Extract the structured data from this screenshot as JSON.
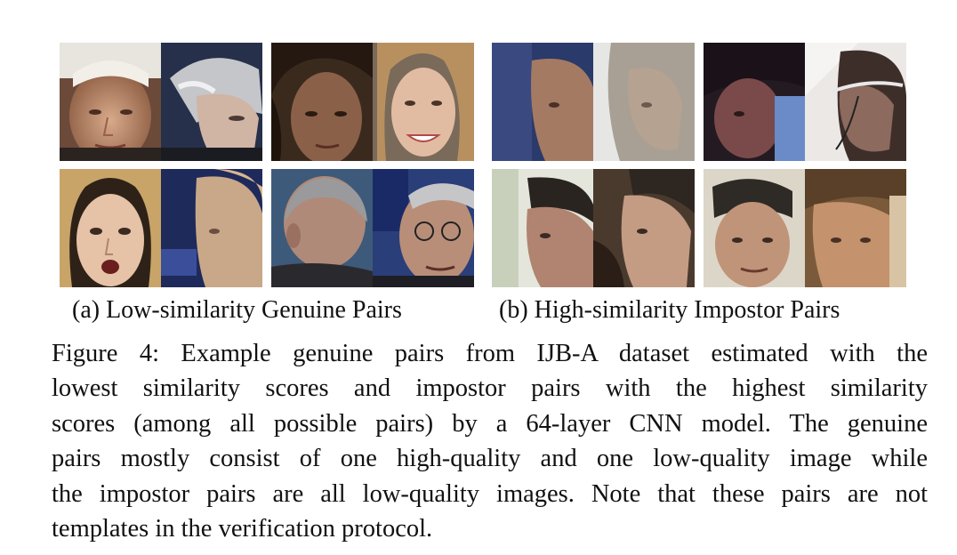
{
  "panels": {
    "a": {
      "label": "(a) Low-similarity Genuine Pairs",
      "faces": [
        "face-older-man-white-hair-frontal",
        "face-grey-haired-man-profile",
        "face-dark-haired-woman-dim",
        "face-blonde-woman-smiling",
        "face-blonde-woman-surprised",
        "face-blonde-woman-blurry-profile",
        "face-balding-man-back-of-head",
        "face-man-with-glasses-profile"
      ]
    },
    "b": {
      "label": "(b) High-similarity Impostor Pairs",
      "faces": [
        "face-blurry-profile-dark",
        "face-blurry-profile-grey",
        "face-dark-blurry-face",
        "face-profile-with-headset",
        "face-dark-haired-profile-left",
        "face-man-profile-right",
        "face-man-low-quality",
        "face-man-blurry-turned"
      ]
    }
  },
  "caption": {
    "lines": [
      "Figure 4: Example genuine pairs from IJB-A dataset estimated with the",
      "lowest similarity scores and impostor pairs with the highest similarity",
      "scores (among all possible pairs) by a 64-layer CNN model. The genuine",
      "pairs mostly consist of one high-quality and one low-quality image while",
      "the impostor pairs are all low-quality images. Note that these pairs are not",
      "templates in the verification protocol."
    ]
  },
  "colors": {
    "text": "#111111",
    "background": "#ffffff"
  }
}
